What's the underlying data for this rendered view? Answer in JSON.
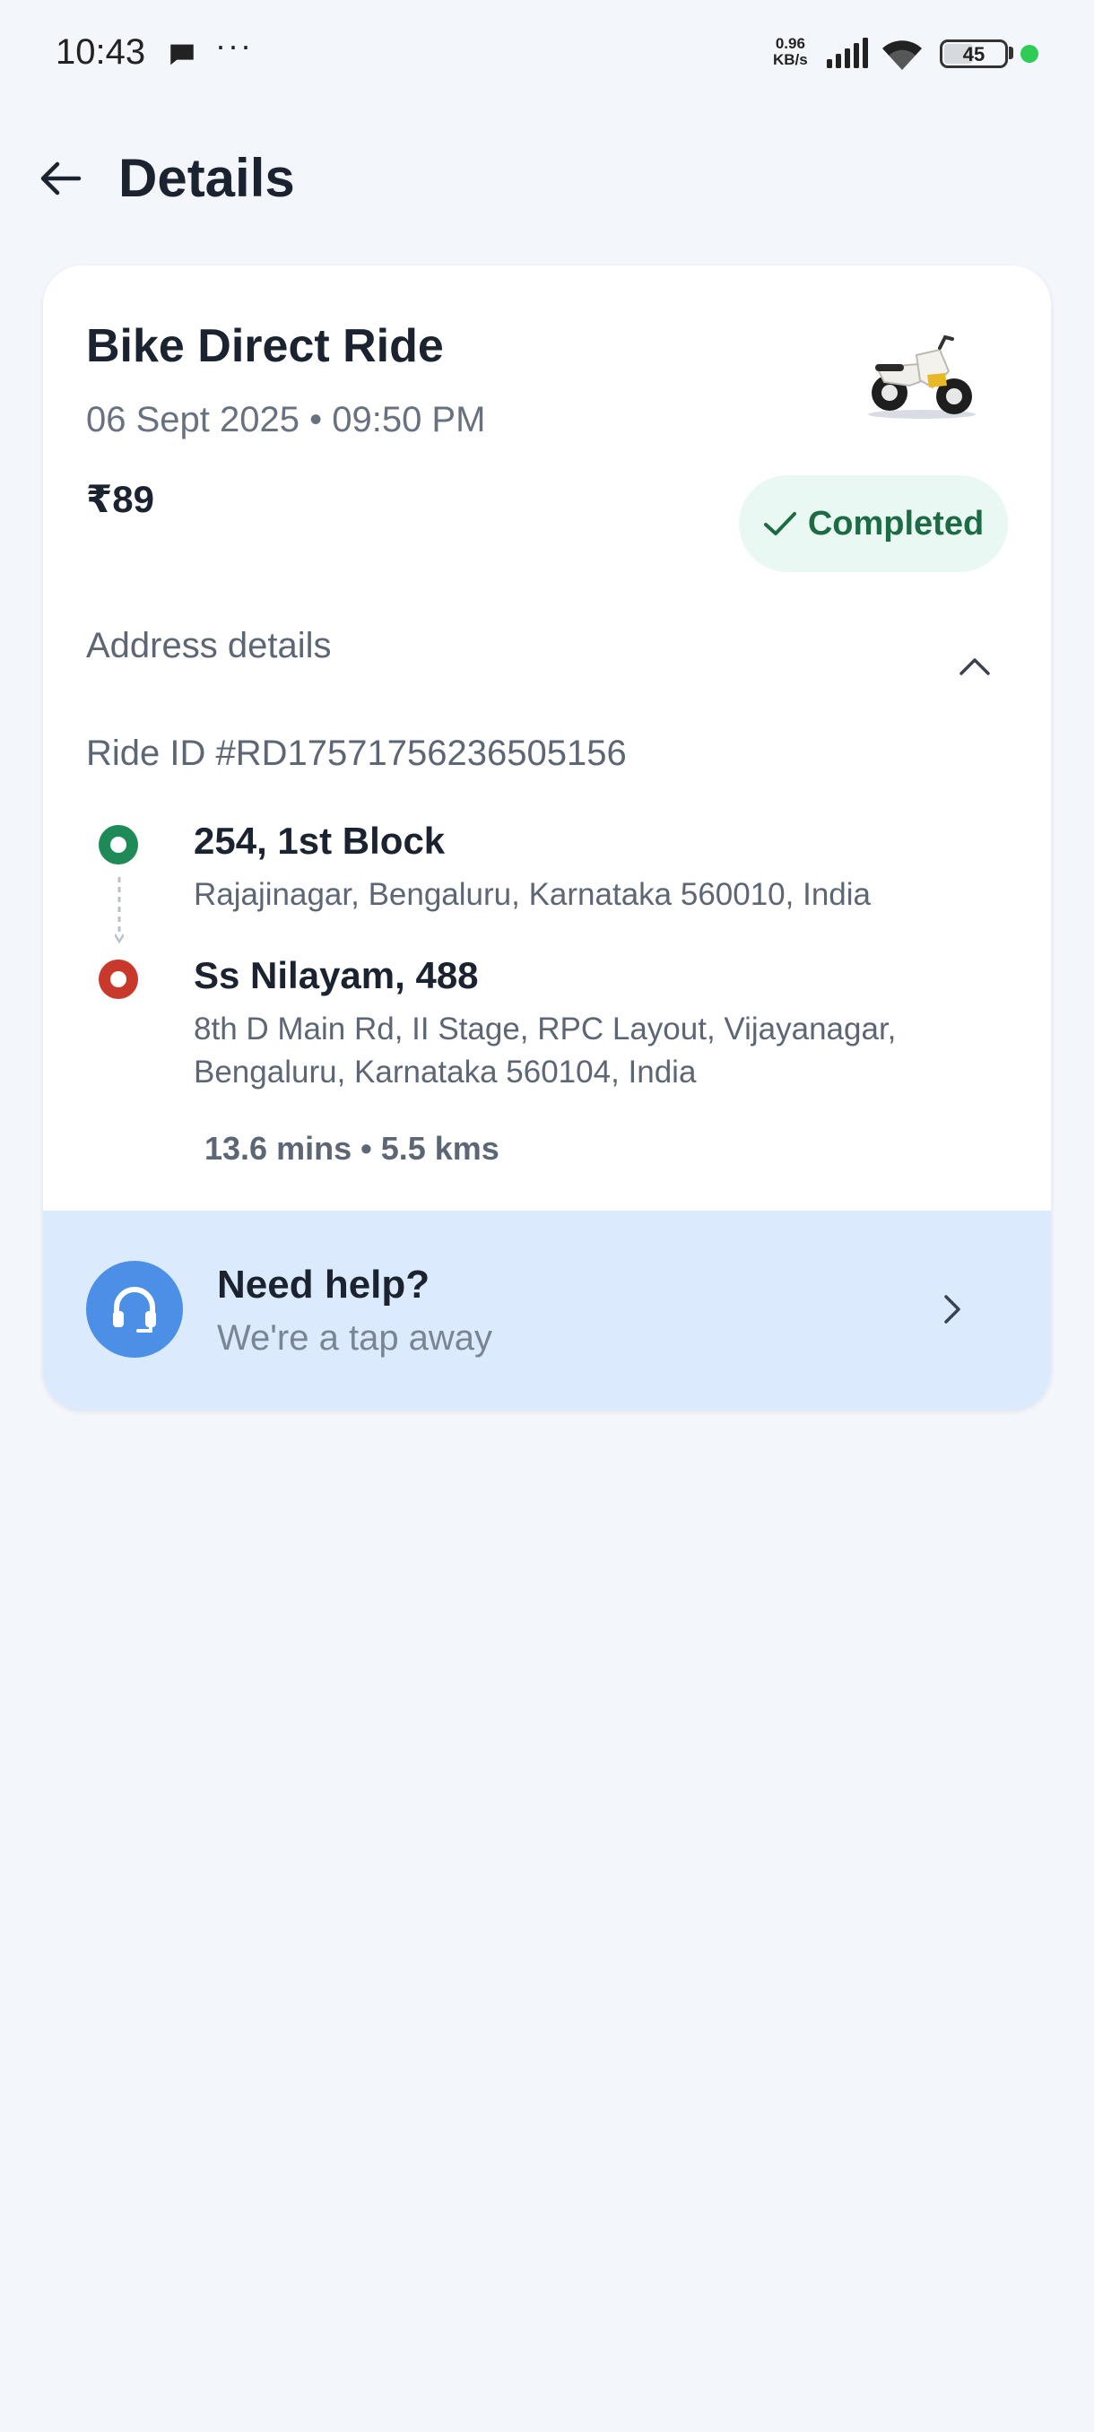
{
  "status_bar": {
    "time": "10:43",
    "more": "···",
    "net_speed_value": "0.96",
    "net_speed_unit": "KB/s",
    "battery": "45",
    "icons": [
      "chat-icon",
      "signal-icon",
      "wifi-icon",
      "battery-icon"
    ]
  },
  "header": {
    "title": "Details"
  },
  "ride": {
    "title": "Bike Direct Ride",
    "date": "06 Sept 2025 • 09:50 PM",
    "price": "₹89",
    "status": "Completed",
    "status_color": "#1d6b45",
    "status_bg": "#e9f8f3"
  },
  "address": {
    "heading": "Address details",
    "ride_id": "Ride ID #RD17571756236505156",
    "pickup": {
      "name": "254, 1st Block",
      "address": "Rajajinagar, Bengaluru, Karnataka 560010, India",
      "color": "#1e8a57"
    },
    "drop": {
      "name": "Ss Nilayam, 488",
      "address": "8th D Main Rd, II Stage, RPC Layout, Vijayanagar, Bengaluru, Karnataka 560104, India",
      "color": "#c8392b"
    },
    "trip_meta": "13.6 mins • 5.5 kms"
  },
  "help": {
    "title": "Need help?",
    "subtitle": "We're a tap away",
    "icon": "headset-icon",
    "accent": "#4b8fe7",
    "background": "#dbeafc"
  }
}
